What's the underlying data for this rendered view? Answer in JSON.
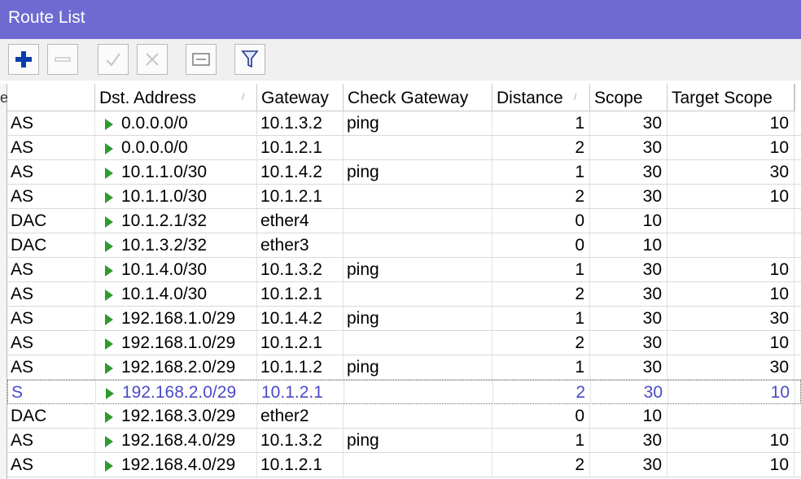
{
  "window": {
    "title": "Route List"
  },
  "toolbar": {
    "buttons": [
      {
        "name": "add-button",
        "icon": "plus-icon"
      },
      {
        "name": "remove-button",
        "icon": "minus-icon"
      },
      {
        "name": "enable-button",
        "icon": "check-icon"
      },
      {
        "name": "disable-button",
        "icon": "x-icon"
      },
      {
        "name": "comment-button",
        "icon": "note-icon"
      },
      {
        "name": "filter-button",
        "icon": "funnel-icon"
      }
    ],
    "accent": "#0a3ea8"
  },
  "table": {
    "left_glyph": "e",
    "columns": {
      "flags": "",
      "dst": "Dst. Address",
      "gateway": "Gateway",
      "check": "Check Gateway",
      "distance": "Distance",
      "scope": "Scope",
      "target": "Target Scope"
    },
    "rows": [
      {
        "flags": "AS",
        "dst": "0.0.0.0/0",
        "gateway": "10.1.3.2",
        "check": "ping",
        "distance": "1",
        "scope": "30",
        "target": "10"
      },
      {
        "flags": "AS",
        "dst": "0.0.0.0/0",
        "gateway": "10.1.2.1",
        "check": "",
        "distance": "2",
        "scope": "30",
        "target": "10"
      },
      {
        "flags": "AS",
        "dst": "10.1.1.0/30",
        "gateway": "10.1.4.2",
        "check": "ping",
        "distance": "1",
        "scope": "30",
        "target": "30"
      },
      {
        "flags": "AS",
        "dst": "10.1.1.0/30",
        "gateway": "10.1.2.1",
        "check": "",
        "distance": "2",
        "scope": "30",
        "target": "10"
      },
      {
        "flags": "DAC",
        "dst": "10.1.2.1/32",
        "gateway": "ether4",
        "check": "",
        "distance": "0",
        "scope": "10",
        "target": ""
      },
      {
        "flags": "DAC",
        "dst": "10.1.3.2/32",
        "gateway": "ether3",
        "check": "",
        "distance": "0",
        "scope": "10",
        "target": ""
      },
      {
        "flags": "AS",
        "dst": "10.1.4.0/30",
        "gateway": "10.1.3.2",
        "check": "ping",
        "distance": "1",
        "scope": "30",
        "target": "10"
      },
      {
        "flags": "AS",
        "dst": "10.1.4.0/30",
        "gateway": "10.1.2.1",
        "check": "",
        "distance": "2",
        "scope": "30",
        "target": "10"
      },
      {
        "flags": "AS",
        "dst": "192.168.1.0/29",
        "gateway": "10.1.4.2",
        "check": "ping",
        "distance": "1",
        "scope": "30",
        "target": "30"
      },
      {
        "flags": "AS",
        "dst": "192.168.1.0/29",
        "gateway": "10.1.2.1",
        "check": "",
        "distance": "2",
        "scope": "30",
        "target": "10"
      },
      {
        "flags": "AS",
        "dst": "192.168.2.0/29",
        "gateway": "10.1.1.2",
        "check": "ping",
        "distance": "1",
        "scope": "30",
        "target": "30"
      },
      {
        "flags": "S",
        "dst": "192.168.2.0/29",
        "gateway": "10.1.2.1",
        "check": "",
        "distance": "2",
        "scope": "30",
        "target": "10",
        "selected": true
      },
      {
        "flags": "DAC",
        "dst": "192.168.3.0/29",
        "gateway": "ether2",
        "check": "",
        "distance": "0",
        "scope": "10",
        "target": ""
      },
      {
        "flags": "AS",
        "dst": "192.168.4.0/29",
        "gateway": "10.1.3.2",
        "check": "ping",
        "distance": "1",
        "scope": "30",
        "target": "10"
      },
      {
        "flags": "AS",
        "dst": "192.168.4.0/29",
        "gateway": "10.1.2.1",
        "check": "",
        "distance": "2",
        "scope": "30",
        "target": "10"
      }
    ]
  }
}
